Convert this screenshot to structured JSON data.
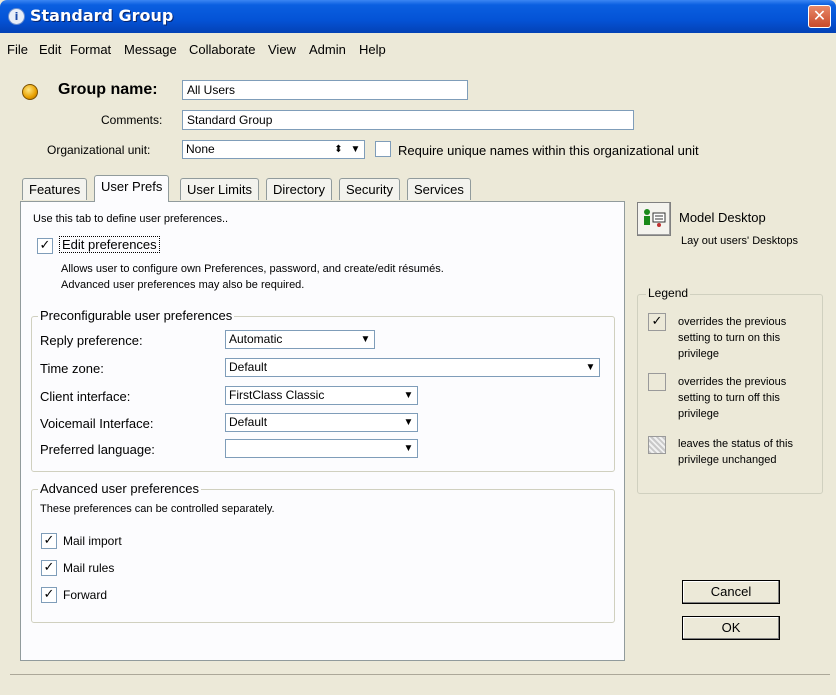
{
  "window": {
    "title": "Standard Group"
  },
  "menu": [
    "File",
    "Edit",
    "Format",
    "Message",
    "Collaborate",
    "View",
    "Admin",
    "Help"
  ],
  "header": {
    "group_name_label": "Group name:",
    "group_name_value": "All Users",
    "comments_label": "Comments:",
    "comments_value": "Standard Group",
    "org_unit_label": "Organizational unit:",
    "org_unit_value": "None",
    "require_unique_label": "Require unique names within this organizational unit",
    "require_unique_checked": false
  },
  "tabs": [
    "Features",
    "User Prefs",
    "User Limits",
    "Directory",
    "Security",
    "Services"
  ],
  "active_tab": "User Prefs",
  "panel": {
    "intro": "Use this tab to define user preferences..",
    "edit_prefs_label": "Edit preferences",
    "edit_prefs_checked": true,
    "edit_prefs_desc1": "Allows user to configure own Preferences, password, and create/edit résumés.",
    "edit_prefs_desc2": "Advanced user preferences may also be required.",
    "preconf": {
      "title": "Preconfigurable user preferences",
      "reply_label": "Reply preference:",
      "reply_value": "Automatic",
      "timezone_label": "Time zone:",
      "timezone_value": "Default",
      "client_label": "Client interface:",
      "client_value": "FirstClass Classic",
      "voicemail_label": "Voicemail Interface:",
      "voicemail_value": "Default",
      "language_label": "Preferred language:",
      "language_value": ""
    },
    "advanced": {
      "title": "Advanced user preferences",
      "desc": "These preferences can be controlled separately.",
      "mail_import": "Mail import",
      "mail_rules": "Mail rules",
      "forward": "Forward"
    }
  },
  "side": {
    "model_desktop_label": "Model Desktop",
    "model_desktop_desc": "Lay out users' Desktops",
    "legend_title": "Legend",
    "legend_on": "overrides the previous setting to turn on this privilege",
    "legend_off": "overrides the previous setting to turn off this privilege",
    "legend_unchanged": "leaves the status of this privilege unchanged",
    "cancel_label": "Cancel",
    "ok_label": "OK"
  },
  "colors": {
    "titlebar": "#0453d6",
    "dialog_bg": "#ece9d8",
    "panel_bg": "#fcfcfe",
    "input_border": "#7f9db9"
  }
}
